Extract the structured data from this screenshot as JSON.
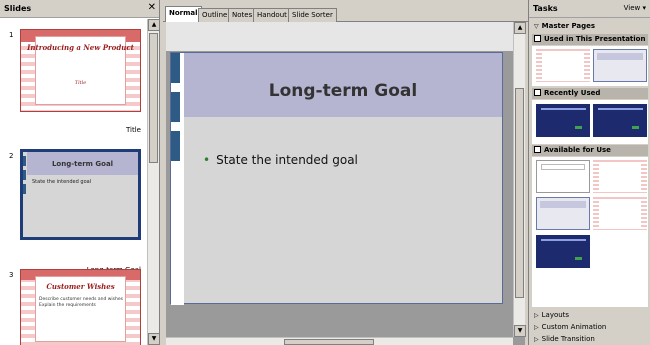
{
  "slides_panel": {
    "title": "Slides",
    "close_symbol": "✕",
    "slides": [
      {
        "number": "1",
        "title": "Introducing a New Product",
        "subtitle": "Title",
        "caption": "Title"
      },
      {
        "number": "2",
        "title": "Long-term Goal",
        "bullet": "State the intended goal",
        "caption": "Long-term Goal"
      },
      {
        "number": "3",
        "title": "Customer Wishes",
        "bullets": [
          "Describe customer needs and wishes",
          "Explain the requirements"
        ]
      }
    ]
  },
  "view_tabs": [
    "Normal",
    "Outline",
    "Notes",
    "Handout",
    "Slide Sorter"
  ],
  "active_tab": "Normal",
  "current_slide": {
    "title": "Long-term Goal",
    "bullet": "State the intended goal",
    "bullet_symbol": "•"
  },
  "tasks_panel": {
    "title": "Tasks",
    "view_label": "View ▾",
    "master_pages_label": "Master Pages",
    "sections": {
      "used": "Used in This Presentation",
      "recent": "Recently Used",
      "available": "Available for Use"
    },
    "collapsed_items": [
      "Layouts",
      "Custom Animation",
      "Slide Transition"
    ]
  },
  "colors": {
    "accent_blue": "#2e5a86",
    "title_band": "#b5b5d2",
    "stripe_red": "#d86a6a",
    "master_blue": "#1d2b6e"
  },
  "icons": {
    "close": "close-icon",
    "scroll_up": "arrow-up-icon",
    "scroll_down": "arrow-down-icon",
    "expand": "triangle-right-icon",
    "collapse": "triangle-down-icon"
  }
}
